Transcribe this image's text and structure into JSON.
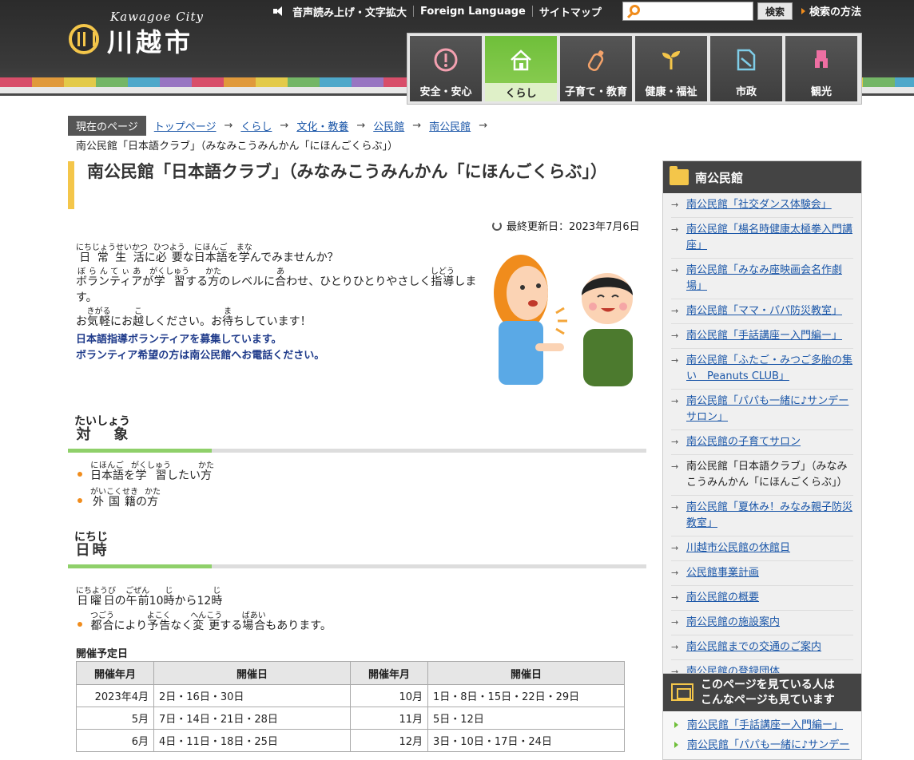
{
  "header": {
    "logo_sub": "Kawagoe City",
    "logo_name": "川越市",
    "utility": [
      "音声読み上げ・文字拡大",
      "Foreign Language",
      "サイトマップ"
    ],
    "search_placeholder": "",
    "search_button": "検索",
    "search_help": "検索の方法"
  },
  "nav": [
    {
      "label": "安全・安心",
      "icon": "alert-icon"
    },
    {
      "label": "くらし",
      "icon": "house-icon"
    },
    {
      "label": "子育て・教育",
      "icon": "baby-bottle-icon"
    },
    {
      "label": "健康・福祉",
      "icon": "sprout-icon"
    },
    {
      "label": "市政",
      "icon": "document-icon"
    },
    {
      "label": "観光",
      "icon": "welcome-tower-icon"
    }
  ],
  "breadcrumb": {
    "label": "現在のページ",
    "items": [
      "トップページ",
      "くらし",
      "文化・教養",
      "公民館",
      "南公民館"
    ],
    "current": "南公民館「日本語クラブ」（みなみこうみんかん「にほんごくらぶ」）"
  },
  "main": {
    "title": "南公民館「日本語クラブ」（みなみこうみんかん「にほんごくらぶ」）",
    "updated": "最終更新日：2023年7月6日",
    "notice1": "日本語指導ボランティアを募集しています。",
    "notice2": "ボランティア希望の方は南公民館へお電話ください。",
    "h_target": "対　象",
    "h_target_ruby": "たいしょう",
    "h_date": "日時",
    "h_date_ruby": "にちじ",
    "sched_label": "開催予定日",
    "table_headers": [
      "開催年月",
      "開催日",
      "開催年月",
      "開催日"
    ],
    "table_rows": [
      [
        "2023年4月",
        "2日・16日・30日",
        "10月",
        "1日・8日・15日・22日・29日"
      ],
      [
        "5月",
        "7日・14日・21日・28日",
        "11月",
        "5日・12日"
      ],
      [
        "6月",
        "4日・11日・18日・25日",
        "12月",
        "3日・10日・17日・24日"
      ]
    ]
  },
  "sidebar": {
    "title": "南公民館",
    "items": [
      "南公民館「社交ダンス体験会」",
      "南公民館「楊名時健康太極拳入門講座」",
      "南公民館「みなみ座映画会名作劇場」",
      "南公民館「ママ・パパ防災教室」",
      "南公民館「手話講座ー入門編ー」",
      "南公民館「ふたご・みつご多胎の集い　Peanuts CLUB」",
      "南公民館「パパも一緒に♪サンデーサロン」",
      "南公民館の子育てサロン",
      "南公民館「日本語クラブ」（みなみこうみんかん「にほんごくらぶ」）",
      "南公民館「夏休み！みなみ親子防災教室」",
      "川越市公民館の休館日",
      "公民館事業計画",
      "南公民館の概要",
      "南公民館の施設案内",
      "南公民館までの交通のご案内",
      "南公民館の登録団体"
    ],
    "current_index": 8,
    "related_title1": "このページを見ている人は",
    "related_title2": "こんなページも見ています",
    "related": [
      "南公民館「手話講座ー入門編ー」",
      "南公民館「パパも一緒に♪サンデー"
    ]
  }
}
